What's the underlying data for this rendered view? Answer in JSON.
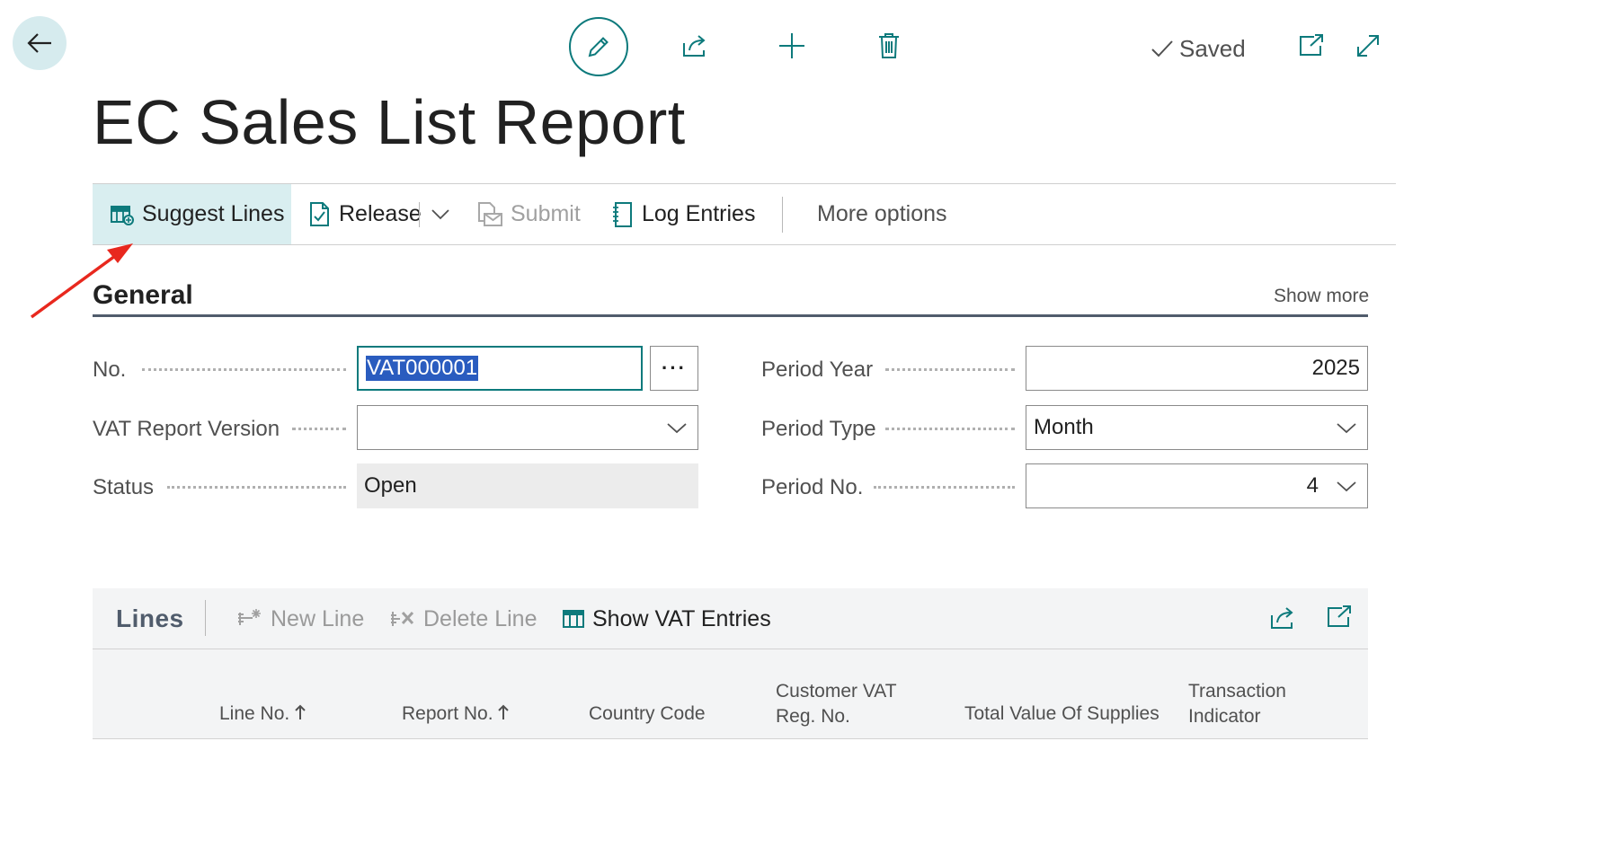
{
  "header": {
    "saved_label": "Saved",
    "page_title": "EC Sales List Report"
  },
  "actions": {
    "suggest_lines": "Suggest Lines",
    "release": "Release",
    "submit": "Submit",
    "log_entries": "Log Entries",
    "more_options": "More options"
  },
  "general": {
    "title": "General",
    "show_more": "Show more",
    "fields": {
      "no_label": "No.",
      "no_value": "VAT000001",
      "vat_report_version_label": "VAT Report Version",
      "vat_report_version_value": "",
      "status_label": "Status",
      "status_value": "Open",
      "period_year_label": "Period Year",
      "period_year_value": "2025",
      "period_type_label": "Period Type",
      "period_type_value": "Month",
      "period_no_label": "Period No.",
      "period_no_value": "4"
    },
    "assist_button": "···"
  },
  "lines": {
    "title": "Lines",
    "new_line": "New Line",
    "delete_line": "Delete Line",
    "show_vat_entries": "Show VAT Entries",
    "columns": {
      "line_no": "Line No.",
      "report_no": "Report No.",
      "country_code": "Country Code",
      "customer_vat_1": "Customer VAT",
      "customer_vat_2": "Reg. No.",
      "total_value": "Total Value Of Supplies",
      "transaction_1": "Transaction",
      "transaction_2": "Indicator"
    }
  },
  "colors": {
    "accent": "#0d7a7c",
    "highlight": "#d9eef0",
    "selection": "#2a5cbf",
    "annotation_arrow": "#e8281e"
  },
  "icons": {
    "back": "arrow-left-icon",
    "edit": "pencil-icon",
    "share": "share-icon",
    "new": "plus-icon",
    "delete": "trash-icon",
    "saved": "checkmark-icon",
    "open_new_window": "open-new-window-icon",
    "expand": "expand-icon"
  }
}
